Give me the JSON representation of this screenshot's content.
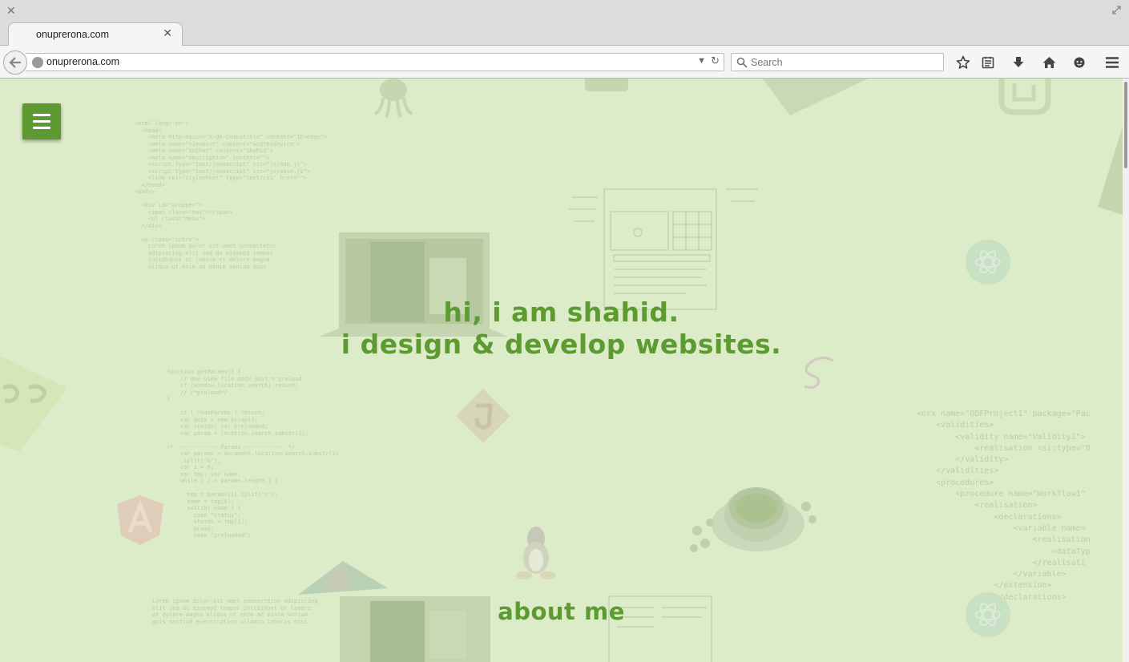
{
  "browser": {
    "tab_title": "onuprerona.com",
    "url": "onuprerona.com",
    "search_placeholder": "Search",
    "toolbar_icons": [
      "bookmark-star-icon",
      "reading-list-icon",
      "download-icon",
      "home-icon",
      "chat-icon",
      "menu-icon"
    ]
  },
  "page": {
    "hero_line1": "hi, i am shahid.",
    "hero_line2": "i design & develop websites.",
    "about_heading": "about me",
    "accent_color": "#5e9a32",
    "background_color": "#dcebc8"
  }
}
